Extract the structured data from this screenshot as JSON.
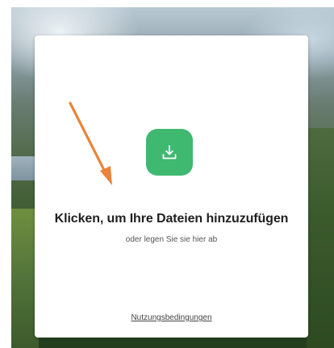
{
  "upload_card": {
    "icon": "download-icon",
    "accent_color": "#3fb870",
    "headline": "Klicken, um Ihre Dateien hinzuzufügen",
    "subline": "oder legen Sie sie hier ab",
    "terms_link": "Nutzungsbedingungen"
  },
  "annotation": {
    "type": "arrow",
    "color": "#e9843a"
  }
}
